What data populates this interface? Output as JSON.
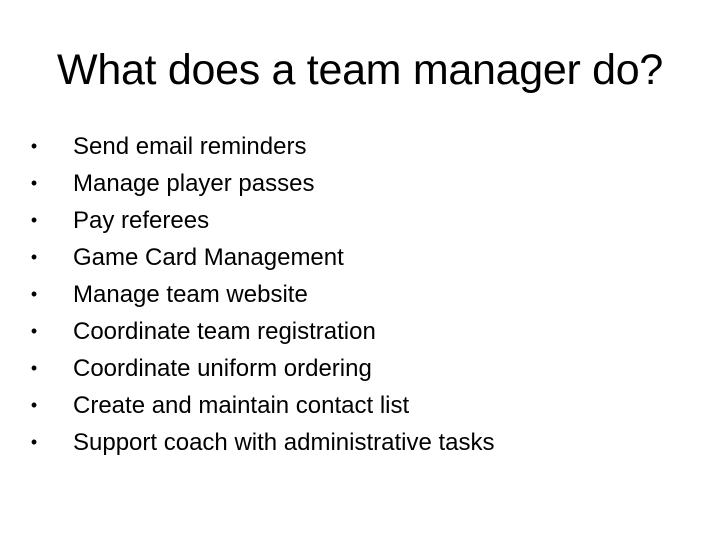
{
  "slide": {
    "title": "What does a team manager do?",
    "bullet_glyph": "•",
    "bullets": [
      "Send email reminders",
      "Manage player passes",
      "Pay referees",
      "Game Card Management",
      "Manage team website",
      "Coordinate team registration",
      "Coordinate uniform ordering",
      "Create and maintain contact list",
      "Support coach with administrative tasks"
    ]
  }
}
